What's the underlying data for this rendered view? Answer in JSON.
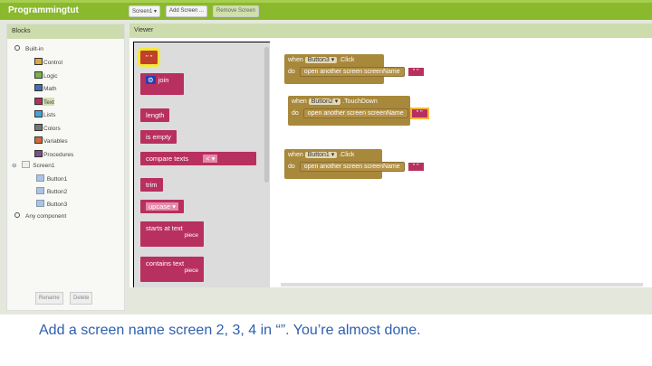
{
  "app": {
    "title": "Programmingtut",
    "screen_select": "Screen1 ▾",
    "add_screen": "Add Screen ...",
    "remove_screen": "Remove Screen"
  },
  "blocks_panel": {
    "title": "Blocks",
    "builtin": "Built-in",
    "categories": [
      {
        "label": "Control",
        "color": "#d8a93c"
      },
      {
        "label": "Logic",
        "color": "#7bb347"
      },
      {
        "label": "Math",
        "color": "#3f70b5"
      },
      {
        "label": "Text",
        "color": "#b8305f"
      },
      {
        "label": "Lists",
        "color": "#43a5d6"
      },
      {
        "label": "Colors",
        "color": "#777777"
      },
      {
        "label": "Variables",
        "color": "#d4693a"
      },
      {
        "label": "Procedures",
        "color": "#7d4f8a"
      }
    ],
    "screen": "Screen1",
    "components": [
      "Button1",
      "Button2",
      "Button3"
    ],
    "any_component": "Any component",
    "rename": "Rename",
    "delete": "Delete"
  },
  "viewer": {
    "title": "Viewer",
    "flyout": [
      "\" \"",
      "join",
      "length",
      "is empty",
      "compare texts",
      "trim",
      "upcase",
      "starts at text",
      "contains text"
    ],
    "flyout_extra": {
      "compare_op": "< ▾",
      "upcase_dd": "upcase ▾",
      "piece": "piece"
    },
    "events": [
      {
        "component": "Button3 ▾",
        "event": ".Click",
        "do": "do",
        "when": "when",
        "action": "open another screen  screenName",
        "arg": "\" \""
      },
      {
        "component": "Button2 ▾",
        "event": ".TouchDown",
        "do": "do",
        "when": "when",
        "action": "open another screen  screenName",
        "arg": "\" \""
      },
      {
        "component": "Button1 ▾",
        "event": ".Click",
        "do": "do",
        "when": "when",
        "action": "open another screen  screenName",
        "arg": "\" \""
      }
    ]
  },
  "caption": "Add a screen name screen 2, 3, 4 in “”. You’re almost done."
}
